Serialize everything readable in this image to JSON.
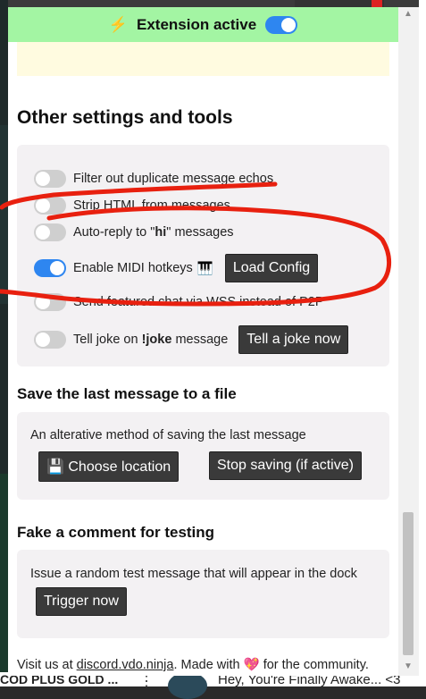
{
  "background": {
    "bottom_left_text": "COD PLUS GOLD ...",
    "bottom_right_text": "Hey, You're Finally Awake... <3",
    "more_menu": "⋮"
  },
  "header": {
    "icon": "lightning-bolt-icon",
    "title": "Extension active",
    "toggle_on": true
  },
  "other_settings": {
    "title": "Other settings and tools",
    "filter_duplicates": "Filter out duplicate message echos",
    "strip_html": "Strip HTML from messages",
    "auto_reply_prefix": "Auto-reply to \"",
    "auto_reply_word": "hi",
    "auto_reply_suffix": "\" messages",
    "midi_label": "Enable MIDI hotkeys",
    "midi_icon": "🎹",
    "load_config": "Load Config",
    "featured_wss": "Send featured chat via WSS instead of P2P",
    "joke_prefix": "Tell joke on ",
    "joke_cmd": "!joke",
    "joke_suffix": " message",
    "joke_button": "Tell a joke now"
  },
  "save_section": {
    "title": "Save the last message to a file",
    "description": "An alterative method of saving the last message",
    "choose_icon": "💾",
    "choose_label": "Choose location",
    "stop_label": "Stop saving (if active)"
  },
  "fake_section": {
    "title": "Fake a comment for testing",
    "description": "Issue a random test message that will appear in the dock",
    "trigger_label": "Trigger now"
  },
  "footer": {
    "prefix": "Visit us at ",
    "link": "discord.vdo.ninja",
    "middle": ". Made with ",
    "heart": "💖",
    "suffix": " for the community."
  },
  "annotation_color": "#e8200f"
}
